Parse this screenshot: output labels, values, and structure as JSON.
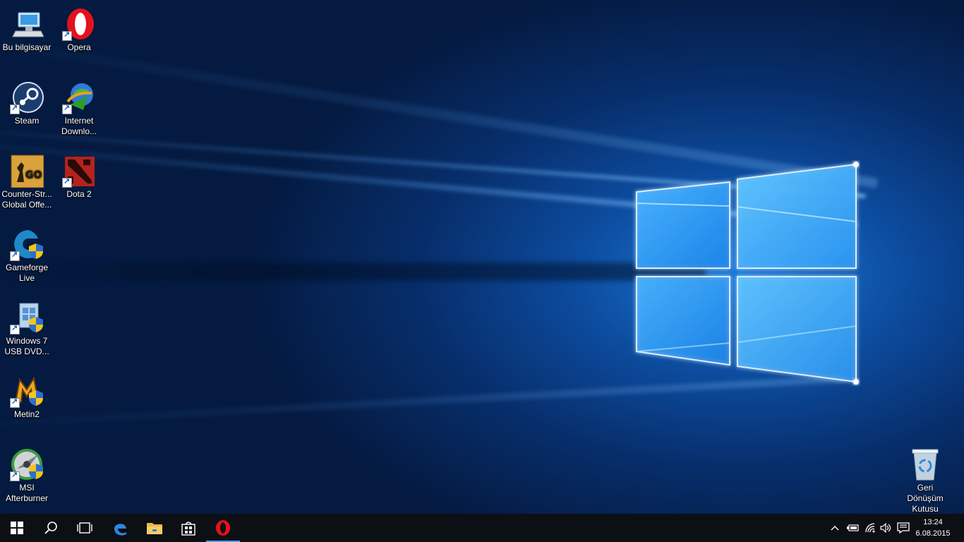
{
  "desktop": {
    "icons": [
      {
        "label": "Bu bilgisayar",
        "icon": "computer-icon"
      },
      {
        "label": "Opera",
        "icon": "opera-icon"
      },
      {
        "label": "Steam",
        "icon": "steam-icon"
      },
      {
        "label": "Internet Downlo...",
        "icon": "internet-download-manager-icon"
      },
      {
        "label": "Counter-Str... Global Offe...",
        "icon": "csgo-icon"
      },
      {
        "label": "Dota 2",
        "icon": "dota2-icon"
      },
      {
        "label": "Gameforge Live",
        "icon": "gameforge-icon"
      },
      {
        "label": "Windows 7 USB DVD...",
        "icon": "windows-usb-tool-icon"
      },
      {
        "label": "Metin2",
        "icon": "metin2-icon"
      },
      {
        "label": "MSI Afterburner",
        "icon": "msi-afterburner-icon"
      },
      {
        "label": "Geri Dönüşüm Kutusu",
        "icon": "recycle-bin-icon"
      }
    ]
  },
  "taskbar": {
    "buttons": [
      {
        "name": "start",
        "icon": "windows-start-icon"
      },
      {
        "name": "search",
        "icon": "search-icon"
      },
      {
        "name": "task-view",
        "icon": "task-view-icon"
      },
      {
        "name": "edge",
        "icon": "edge-icon"
      },
      {
        "name": "file-explorer",
        "icon": "folder-icon"
      },
      {
        "name": "store",
        "icon": "store-icon"
      },
      {
        "name": "opera",
        "icon": "opera-icon",
        "active": true
      }
    ],
    "tray": {
      "icons": [
        "chevron-up-icon",
        "battery-icon",
        "wifi-icon",
        "volume-icon",
        "action-center-icon"
      ],
      "time": "13:24",
      "date": "6.08.2015"
    }
  },
  "colors": {
    "accent": "#4ca0e8",
    "taskbar": "#0c0f14",
    "wallpaper_glow": "#1a78d8"
  }
}
